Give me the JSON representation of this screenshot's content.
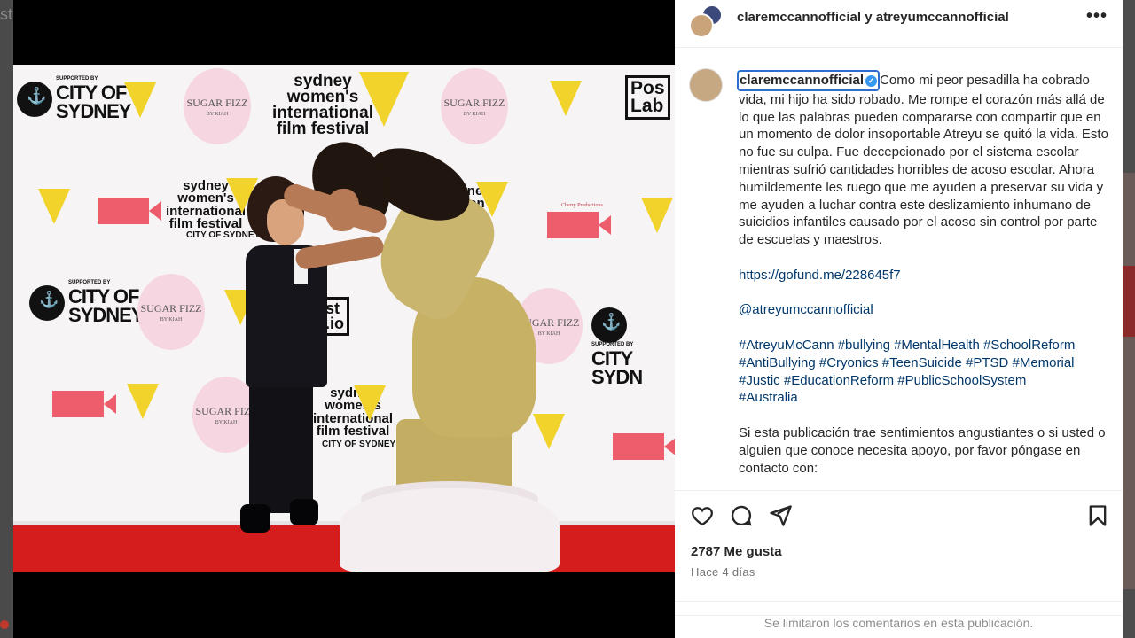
{
  "backdrop": {
    "left_text": "st"
  },
  "post": {
    "header_names": "claremccannofficial y atreyumccannofficial",
    "author": "claremccannofficial",
    "caption_paragraphs": [
      "Como mi peor pesadilla ha cobrado vida, mi hijo ha sido robado. Me rompe el corazón más allá de lo que las palabras pueden compararse con compartir que en un momento de dolor insoportable Atreyu se quitó la vida. Esto no fue su culpa. Fue decepcionado por el sistema escolar mientras sufrió cantidades horribles de acoso escolar. Ahora humildemente les ruego que me ayuden a preservar su vida y me ayuden a luchar contra este deslizamiento inhumano de suicidios infantiles causado por el acoso sin control por parte de escuelas y maestros."
    ],
    "link": "https://gofund.me/228645f7",
    "mention": "@atreyumccannofficial",
    "hashtags_line1": "#AtreyuMcCann #bullying #MentalHealth #SchoolReform",
    "hashtags_line2": "#AntiBullying #Cryonics #TeenSuicide #PTSD #Memorial",
    "hashtags_line3": "#Justic #EducationReform #PublicSchoolSystem",
    "hashtags_line4": "#Australia",
    "closing": "Si esta publicación trae sentimientos angustiantes o si usted o alguien que conoce necesita apoyo, por favor póngase en contacto con:",
    "likes": "2787 Me gusta",
    "time": "Hace 4 días",
    "comments_limited": "Se limitaron los comentarios en esta publicación."
  },
  "photo_backdrop": {
    "city_sup": "SUPPORTED BY",
    "city_line1": "CITY OF",
    "city_line2": "SYDNEY",
    "city_right_line1": "CITY",
    "city_right_line2": "SYDN",
    "sugar_line1": "SUGAR FIZZ",
    "sugar_line2": "BY KIAH",
    "fest_line1": "sydney",
    "fest_line2": "women's",
    "fest_line3": "international",
    "fest_line4": "film festival",
    "cherry": "Cherry Productions",
    "postlab_line1": "Pos",
    "postlab_line2": "Lab",
    "st_io_line1": "st",
    "st_io_line2": ".io",
    "small_city": "CITY OF SYDNEY"
  },
  "icons": {
    "more": "more-horizontal-icon",
    "like": "heart-icon",
    "comment": "comment-icon",
    "share": "send-icon",
    "save": "bookmark-icon",
    "verified": "verified-badge-icon",
    "user_tag": "user-tag-icon"
  },
  "colors": {
    "link": "#00376b",
    "verified": "#3897f0",
    "focus_outline": "#2f6ccf",
    "carpet": "#d61d1d",
    "wheat": "#f1d32c"
  }
}
